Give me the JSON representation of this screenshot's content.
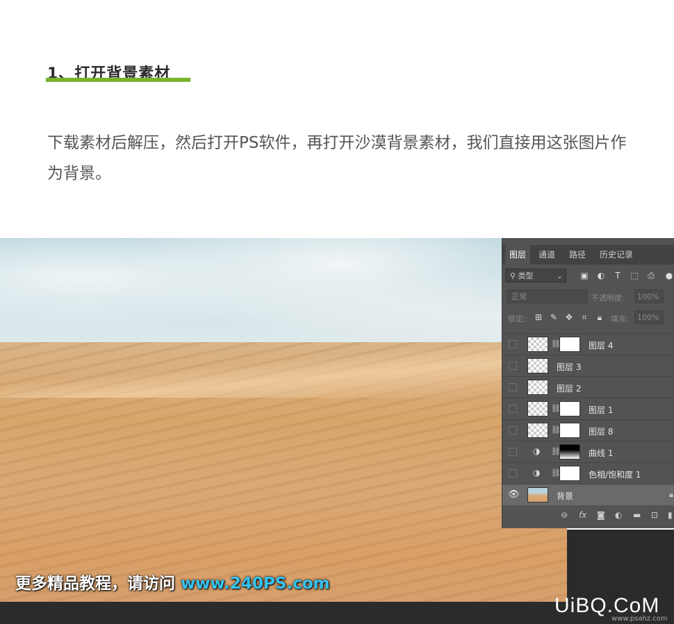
{
  "article": {
    "heading": "1、打开背景素材",
    "body": "下载素材后解压，然后打开PS软件，再打开沙漠背景素材，我们直接用这张图片作为背景。"
  },
  "watermark": {
    "prefix": "更多精品教程，请访问 ",
    "url": "www.240PS.com"
  },
  "brand": {
    "logo": "UiBQ.CoM",
    "sub": "www.psahz.com"
  },
  "layers_panel": {
    "tabs": [
      "图层",
      "通道",
      "路径",
      "历史记录"
    ],
    "active_tab": "图层",
    "filter_label": "类型",
    "blend_mode": "正常",
    "opacity_label": "不透明度:",
    "opacity_value": "100%",
    "lock_label": "锁定:",
    "fill_label": "填充:",
    "fill_value": "100%",
    "layers": [
      {
        "name": "图层 4",
        "type": "smart-with-mask",
        "visible": false
      },
      {
        "name": "图层 3",
        "type": "pixel",
        "visible": false
      },
      {
        "name": "图层 2",
        "type": "pixel",
        "visible": false
      },
      {
        "name": "图层 1",
        "type": "pixel-with-mask",
        "visible": false
      },
      {
        "name": "图层 8",
        "type": "smart-with-mask",
        "visible": false
      },
      {
        "name": "曲线 1",
        "type": "adjustment-curves",
        "visible": false
      },
      {
        "name": "色相/饱和度 1",
        "type": "adjustment-hue",
        "visible": false
      },
      {
        "name": "背景",
        "type": "background",
        "visible": true,
        "selected": true
      }
    ],
    "bottom_tools": [
      "link-icon",
      "fx-icon",
      "mask-icon",
      "adjustment-icon",
      "folder-icon",
      "new-layer-icon",
      "trash-icon"
    ]
  }
}
